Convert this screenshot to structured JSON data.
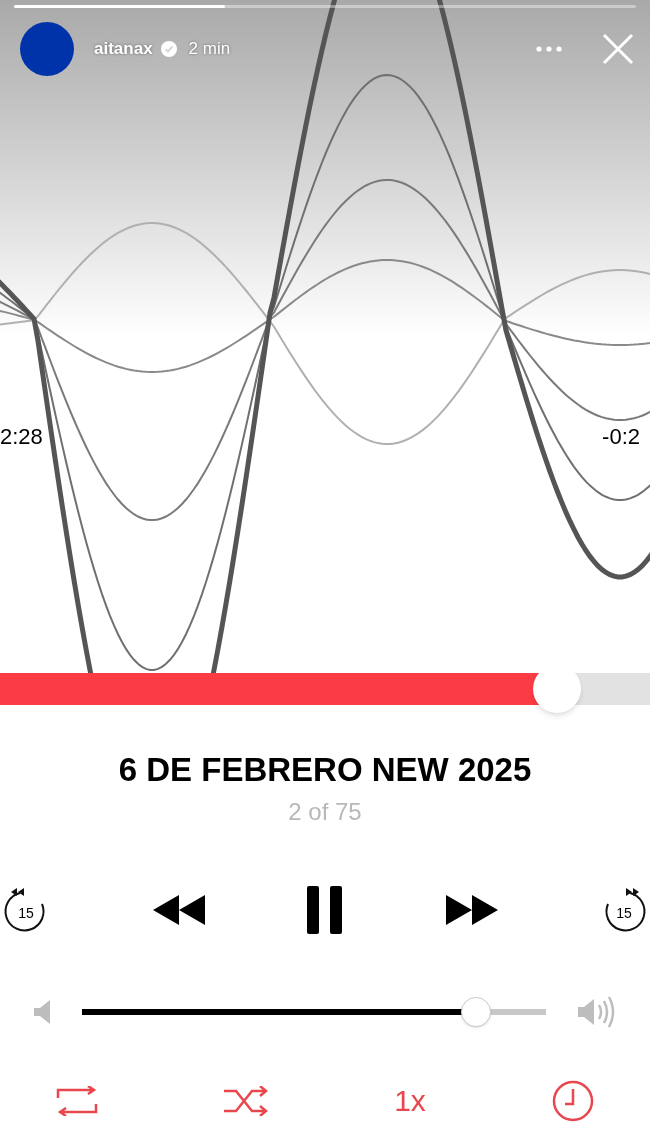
{
  "story": {
    "progress": {
      "level": 0.34
    },
    "user": {
      "name": "aitanax",
      "verified": true,
      "time": "2 min"
    }
  },
  "player": {
    "elapsed": "2:28",
    "remaining": "-0:2",
    "scrubber": {
      "level": 0.857
    },
    "title": "6 DE FEBRERO NEW 2025",
    "position": "2 of 75",
    "skip_back": {
      "label": "15"
    },
    "skip_forward": {
      "label": "15"
    },
    "volume": {
      "level": 0.85
    },
    "speed": "1x"
  }
}
